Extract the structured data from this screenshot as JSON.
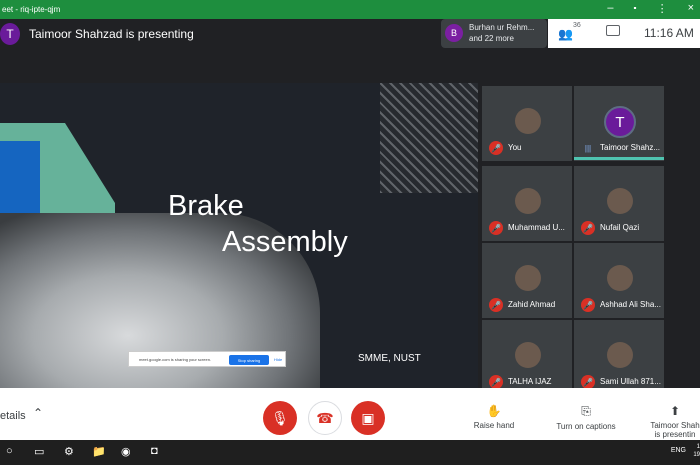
{
  "browser": {
    "tab_title": "eet - riq-ipte-qjm"
  },
  "header": {
    "presenter_initial": "T",
    "presenting_text": "Taimoor Shahzad is presenting",
    "participants_chip": {
      "avatar_initial": "B",
      "line1": "Burhan ur Rehm...",
      "line2": "and 22 more"
    },
    "people_count": "36",
    "clock": "11:16 AM"
  },
  "slide": {
    "title_line1": "Brake",
    "title_line2": "Assembly",
    "footer": "SMME, NUST",
    "share_notice": "meet.google.com is sharing your screen.",
    "stop_sharing_label": "Stop sharing",
    "hide_label": "Hide"
  },
  "participants": [
    {
      "name": "You"
    },
    {
      "name": "Taimoor Shahz...",
      "initial": "T"
    },
    {
      "name": "Muhammad U..."
    },
    {
      "name": "Nufail Qazi"
    },
    {
      "name": "Zahid Ahmad"
    },
    {
      "name": "Ashhad Ali Sha..."
    },
    {
      "name": "TALHA IJAZ"
    },
    {
      "name": "Sami Ullah 871..."
    }
  ],
  "controls": {
    "details_label": "etails",
    "raise_hand_label": "Raise hand",
    "captions_label": "Turn on captions",
    "present_line1": "Taimoor Shah",
    "present_line2": "is presentin"
  },
  "taskbar": {
    "lang": "ENG",
    "time": "1",
    "date": "19"
  }
}
